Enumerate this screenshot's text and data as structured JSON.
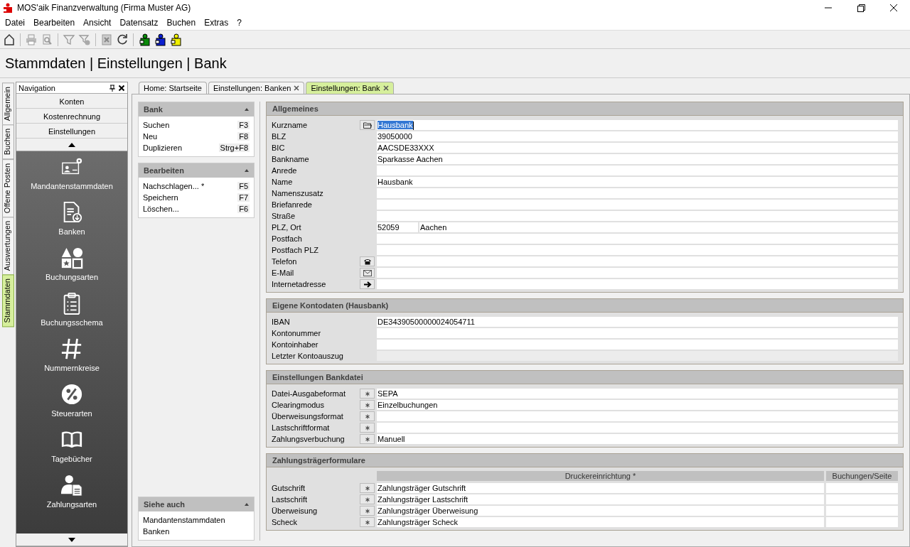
{
  "window": {
    "title": "MOS'aik Finanzverwaltung (Firma Muster AG)"
  },
  "menu": [
    "Datei",
    "Bearbeiten",
    "Ansicht",
    "Datensatz",
    "Buchen",
    "Extras",
    "?"
  ],
  "heading": "Stammdaten | Einstellungen | Bank",
  "side_tabs": [
    {
      "label": "Allgemein",
      "selected": false
    },
    {
      "label": "Buchen",
      "selected": false
    },
    {
      "label": "Offene Posten",
      "selected": false
    },
    {
      "label": "Auswertungen",
      "selected": false
    },
    {
      "label": "Stammdaten",
      "selected": true
    }
  ],
  "navigation": {
    "title": "Navigation",
    "groups": [
      "Konten",
      "Kostenrechnung",
      "Einstellungen"
    ],
    "items": [
      {
        "label": "Mandantenstammdaten",
        "kind": "card"
      },
      {
        "label": "Banken",
        "kind": "document"
      },
      {
        "label": "Buchungsarten",
        "kind": "shapes"
      },
      {
        "label": "Buchungsschema",
        "kind": "clipboard"
      },
      {
        "label": "Nummernkreise",
        "kind": "hash"
      },
      {
        "label": "Steuerarten",
        "kind": "percent"
      },
      {
        "label": "Tagebücher",
        "kind": "book"
      },
      {
        "label": "Zahlungsarten",
        "kind": "person"
      }
    ]
  },
  "tabs": [
    {
      "label": "Home: Startseite",
      "selected": false,
      "closable": false
    },
    {
      "label": "Einstellungen: Banken",
      "selected": false,
      "closable": true
    },
    {
      "label": "Einstellungen: Bank",
      "selected": true,
      "closable": true
    }
  ],
  "task_panes": [
    {
      "title": "Bank",
      "items": [
        {
          "label": "Suchen",
          "shortcut": "F3"
        },
        {
          "label": "Neu",
          "shortcut": "F8"
        },
        {
          "label": "Duplizieren",
          "shortcut": "Strg+F8"
        }
      ]
    },
    {
      "title": "Bearbeiten",
      "items": [
        {
          "label": "Nachschlagen... *",
          "shortcut": "F5"
        },
        {
          "label": "Speichern",
          "shortcut": "F7"
        },
        {
          "label": "Löschen...",
          "shortcut": "F6"
        }
      ]
    }
  ],
  "see_also": {
    "title": "Siehe auch",
    "items": [
      "Mandantenstammdaten",
      "Banken"
    ]
  },
  "sections": [
    {
      "title": "Allgemeines",
      "kind": "form",
      "rows": [
        {
          "label": "Kurzname",
          "button": {
            "kind": "folder"
          },
          "kind": "field",
          "value": "Hausbank",
          "selected": true
        },
        {
          "label": "BLZ",
          "kind": "field",
          "value": "39050000",
          "selected": false
        },
        {
          "label": "BIC",
          "kind": "field",
          "value": "AACSDE33XXX",
          "selected": false
        },
        {
          "label": "Bankname",
          "kind": "field",
          "value": "Sparkasse Aachen",
          "selected": false
        },
        {
          "label": "Anrede",
          "kind": "field",
          "selected": false
        },
        {
          "label": "Name",
          "kind": "field",
          "value": "Hausbank",
          "selected": false
        },
        {
          "label": "Namenszusatz",
          "kind": "field",
          "selected": false
        },
        {
          "label": "Briefanrede",
          "kind": "field",
          "selected": false
        },
        {
          "label": "Straße",
          "kind": "field",
          "selected": false
        },
        {
          "label": "PLZ, Ort",
          "kind": "pair",
          "value": "52059",
          "value_2": "Aachen",
          "selected": false
        },
        {
          "label": "Postfach",
          "kind": "field",
          "selected": false
        },
        {
          "label": "Postfach PLZ",
          "kind": "field",
          "selected": false
        },
        {
          "label": "Telefon",
          "button": {
            "kind": "phone"
          },
          "kind": "field",
          "selected": false
        },
        {
          "label": "E-Mail",
          "button": {
            "kind": "mail"
          },
          "kind": "field",
          "selected": false
        },
        {
          "label": "Internetadresse",
          "button": {
            "kind": "arrow"
          },
          "kind": "field",
          "selected": false
        }
      ]
    },
    {
      "title": "Eigene Kontodaten (Hausbank)",
      "kind": "form",
      "rows": [
        {
          "label": "IBAN",
          "kind": "field",
          "value": "DE34390500000024054711",
          "selected": false
        },
        {
          "label": "Kontonummer",
          "kind": "field",
          "selected": false
        },
        {
          "label": "Kontoinhaber",
          "kind": "field",
          "selected": false
        },
        {
          "label": "Letzter Kontoauszug",
          "kind": "readonly",
          "selected": false
        }
      ]
    },
    {
      "title": "Einstellungen Bankdatei",
      "kind": "form",
      "rows": [
        {
          "label": "Datei-Ausgabeformat",
          "button": {
            "kind": "star"
          },
          "kind": "field",
          "value": "SEPA",
          "selected": false
        },
        {
          "label": "Clearingmodus",
          "button": {
            "kind": "star"
          },
          "kind": "field",
          "value": "Einzelbuchungen",
          "selected": false
        },
        {
          "label": "Überweisungsformat",
          "button": {
            "kind": "star"
          },
          "kind": "field",
          "selected": false
        },
        {
          "label": "Lastschriftformat",
          "button": {
            "kind": "star"
          },
          "kind": "field",
          "selected": false
        },
        {
          "label": "Zahlungsverbuchung",
          "button": {
            "kind": "star"
          },
          "kind": "field",
          "value": "Manuell",
          "selected": false
        }
      ]
    },
    {
      "title": "Zahlungsträgerformulare",
      "kind": "table",
      "columns": [
        "Druckereinrichtung *",
        "Buchungen/Seite"
      ],
      "rows": [
        {
          "label": "Gutschrift",
          "button": {
            "kind": "star"
          },
          "kind": "field",
          "value": "Zahlungsträger Gutschrift",
          "selected": false
        },
        {
          "label": "Lastschrift",
          "button": {
            "kind": "star"
          },
          "kind": "field",
          "value": "Zahlungsträger Lastschrift",
          "selected": false
        },
        {
          "label": "Überweisung",
          "button": {
            "kind": "star"
          },
          "kind": "field",
          "value": "Zahlungsträger Überweisung",
          "selected": false
        },
        {
          "label": "Scheck",
          "button": {
            "kind": "star"
          },
          "kind": "field",
          "value": "Zahlungsträger Scheck",
          "selected": false
        }
      ]
    }
  ]
}
